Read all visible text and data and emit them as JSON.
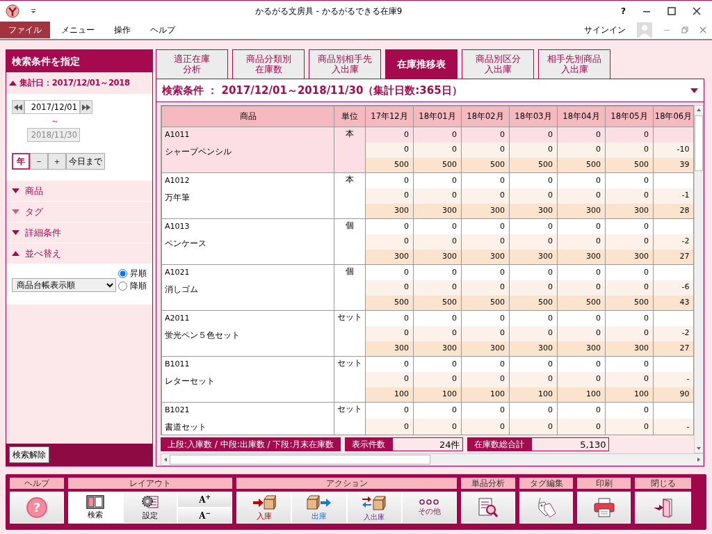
{
  "window": {
    "title": "かるがる文房具 - かるがるできる在庫9",
    "help": "?"
  },
  "menu": [
    {
      "label": "ファイル",
      "selected": true
    },
    {
      "label": "メニュー",
      "selected": false
    },
    {
      "label": "操作",
      "selected": false
    },
    {
      "label": "ヘルプ",
      "selected": false
    }
  ],
  "signin": "サインイン",
  "search_panel": {
    "title": "検索条件を指定",
    "date_section": {
      "label": "集計日：2017/12/01～2018",
      "expanded": true,
      "from": "2017/12/01",
      "tilde": "～",
      "to": "2018/11/30",
      "buttons": [
        {
          "label": "年",
          "selected": true
        },
        {
          "label": "－",
          "selected": false
        },
        {
          "label": "＋",
          "selected": false
        },
        {
          "label": "今日まで",
          "selected": false
        }
      ]
    },
    "sections": [
      {
        "label": "商品",
        "expanded": false
      },
      {
        "label": "タグ",
        "expanded": false
      },
      {
        "label": "詳細条件",
        "expanded": false
      },
      {
        "label": "並べ替え",
        "expanded": true
      }
    ],
    "sort": {
      "value": "商品台帳表示順",
      "options": [
        {
          "label": "昇順",
          "selected": true
        },
        {
          "label": "降順",
          "selected": false
        }
      ]
    },
    "clear_button": "検索解除"
  },
  "tabs": [
    {
      "lines": [
        "適正在庫",
        "分析"
      ],
      "selected": false
    },
    {
      "lines": [
        "商品分類別",
        "在庫数"
      ],
      "selected": false
    },
    {
      "lines": [
        "商品別相手先",
        "入出庫"
      ],
      "selected": false
    },
    {
      "lines": [
        "在庫推移表"
      ],
      "selected": true
    },
    {
      "lines": [
        "商品別区分",
        "入出庫"
      ],
      "selected": false
    },
    {
      "lines": [
        "相手先別商品",
        "入出庫"
      ],
      "selected": false
    }
  ],
  "condition": "検索条件 ： 2017/12/01～2018/11/30（集計日数:365日）",
  "table": {
    "columns": [
      "商品",
      "単位",
      "17年12月",
      "18年01月",
      "18年02月",
      "18年03月",
      "18年04月",
      "18年05月",
      "18年06月"
    ],
    "rows": [
      {
        "code": "A1011",
        "name": "シャープペンシル",
        "unit": "本",
        "selected": true,
        "in": [
          "0",
          "0",
          "0",
          "0",
          "0",
          "0"
        ],
        "out": [
          "0",
          "0",
          "0",
          "0",
          "0",
          "0",
          "-10"
        ],
        "stock": [
          "500",
          "500",
          "500",
          "500",
          "500",
          "500",
          "39"
        ]
      },
      {
        "code": "A1012",
        "name": "万年筆",
        "unit": "本",
        "selected": false,
        "in": [
          "0",
          "0",
          "0",
          "0",
          "0",
          "0"
        ],
        "out": [
          "0",
          "0",
          "0",
          "0",
          "0",
          "0",
          "-1"
        ],
        "stock": [
          "300",
          "300",
          "300",
          "300",
          "300",
          "300",
          "28"
        ]
      },
      {
        "code": "A1013",
        "name": "ペンケース",
        "unit": "個",
        "selected": false,
        "in": [
          "0",
          "0",
          "0",
          "0",
          "0",
          "0"
        ],
        "out": [
          "0",
          "0",
          "0",
          "0",
          "0",
          "0",
          "-2"
        ],
        "stock": [
          "300",
          "300",
          "300",
          "300",
          "300",
          "300",
          "27"
        ]
      },
      {
        "code": "A1021",
        "name": "消しゴム",
        "unit": "個",
        "selected": false,
        "in": [
          "0",
          "0",
          "0",
          "0",
          "0",
          "0"
        ],
        "out": [
          "0",
          "0",
          "0",
          "0",
          "0",
          "0",
          "-6"
        ],
        "stock": [
          "500",
          "500",
          "500",
          "500",
          "500",
          "500",
          "43"
        ]
      },
      {
        "code": "A2011",
        "name": "蛍光ペン５色セット",
        "unit": "セット",
        "selected": false,
        "in": [
          "0",
          "0",
          "0",
          "0",
          "0",
          "0"
        ],
        "out": [
          "0",
          "0",
          "0",
          "0",
          "0",
          "0",
          "-2"
        ],
        "stock": [
          "300",
          "300",
          "300",
          "300",
          "300",
          "300",
          "27"
        ]
      },
      {
        "code": "B1011",
        "name": "レターセット",
        "unit": "セット",
        "selected": false,
        "in": [
          "0",
          "0",
          "0",
          "0",
          "0",
          "0"
        ],
        "out": [
          "0",
          "0",
          "0",
          "0",
          "0",
          "0",
          "-"
        ],
        "stock": [
          "100",
          "100",
          "100",
          "100",
          "100",
          "100",
          "90"
        ]
      },
      {
        "code": "B1021",
        "name": "書道セット",
        "unit": "セット",
        "selected": false,
        "in": [
          "0",
          "0",
          "0",
          "0",
          "0",
          "0"
        ],
        "out": [
          "0",
          "0",
          "0",
          "0",
          "0",
          "0",
          "-"
        ]
      }
    ]
  },
  "footer": {
    "legend": "上段:入庫数 / 中段:出庫数 / 下段:月末在庫数",
    "count_label": "表示件数",
    "count": "24件",
    "total_label": "在庫数総合計",
    "total": "5,130"
  },
  "toolbar": [
    {
      "title": "ヘルプ",
      "buttons": [
        {
          "kind": "help",
          "glyph": "?"
        }
      ]
    },
    {
      "title": "レイアウト",
      "buttons": [
        {
          "kind": "panel",
          "label": "検索",
          "selected": true
        },
        {
          "kind": "settings",
          "label": "設定",
          "selected": false
        },
        {
          "kind": "font",
          "labels": [
            "A$^{+}$",
            "A$^{−}$"
          ]
        }
      ]
    },
    {
      "title": "アクション",
      "buttons": [
        {
          "kind": "in",
          "label": "入庫"
        },
        {
          "kind": "out",
          "label": "出庫"
        },
        {
          "kind": "inout",
          "label": "入出庫"
        },
        {
          "kind": "other",
          "label": "その他"
        }
      ]
    },
    {
      "title": "単品分析",
      "buttons": [
        {
          "kind": "analysis"
        }
      ]
    },
    {
      "title": "タグ編集",
      "buttons": [
        {
          "kind": "tag"
        }
      ]
    },
    {
      "title": "印刷",
      "buttons": [
        {
          "kind": "print"
        }
      ]
    },
    {
      "title": "閉じる",
      "buttons": [
        {
          "kind": "close"
        }
      ]
    }
  ]
}
